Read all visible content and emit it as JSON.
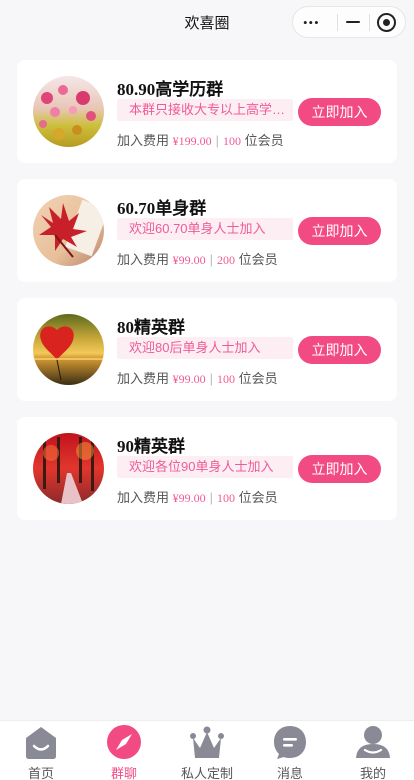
{
  "nav": {
    "title": "欢喜圈",
    "more_icon": "•••"
  },
  "groups": [
    {
      "name": "80.90高学历群",
      "desc": "本群只接收大专以上高学历会员",
      "fee_label": "加入费用",
      "price": "¥199.00",
      "count": "100",
      "member_suffix": "位会员",
      "join_label": "立即加入",
      "avatar": "flower-field-photo"
    },
    {
      "name": "60.70单身群",
      "desc": "欢迎60.70单身人士加入",
      "fee_label": "加入费用",
      "price": "¥99.00",
      "count": "200",
      "member_suffix": "位会员",
      "join_label": "立即加入",
      "avatar": "maple-leaf-photo"
    },
    {
      "name": "80精英群",
      "desc": "欢迎80后单身人士加入",
      "fee_label": "加入费用",
      "price": "¥99.00",
      "count": "100",
      "member_suffix": "位会员",
      "join_label": "立即加入",
      "avatar": "heart-balloon-sunset-photo"
    },
    {
      "name": "90精英群",
      "desc": "欢迎各位90单身人士加入",
      "fee_label": "加入费用",
      "price": "¥99.00",
      "count": "100",
      "member_suffix": "位会员",
      "join_label": "立即加入",
      "avatar": "red-forest-path-photo"
    }
  ],
  "tabbar": {
    "items": [
      {
        "label": "首页",
        "icon": "home-icon"
      },
      {
        "label": "群聊",
        "icon": "compass-icon"
      },
      {
        "label": "私人定制",
        "icon": "crown-icon"
      },
      {
        "label": "消息",
        "icon": "chat-bubble-icon"
      },
      {
        "label": "我的",
        "icon": "user-icon"
      }
    ],
    "active_index": 1
  },
  "colors": {
    "accent": "#f24b83",
    "accent_light": "#fdeef4",
    "tab_inactive": "#8a8a96",
    "background": "#f7f7f9"
  }
}
